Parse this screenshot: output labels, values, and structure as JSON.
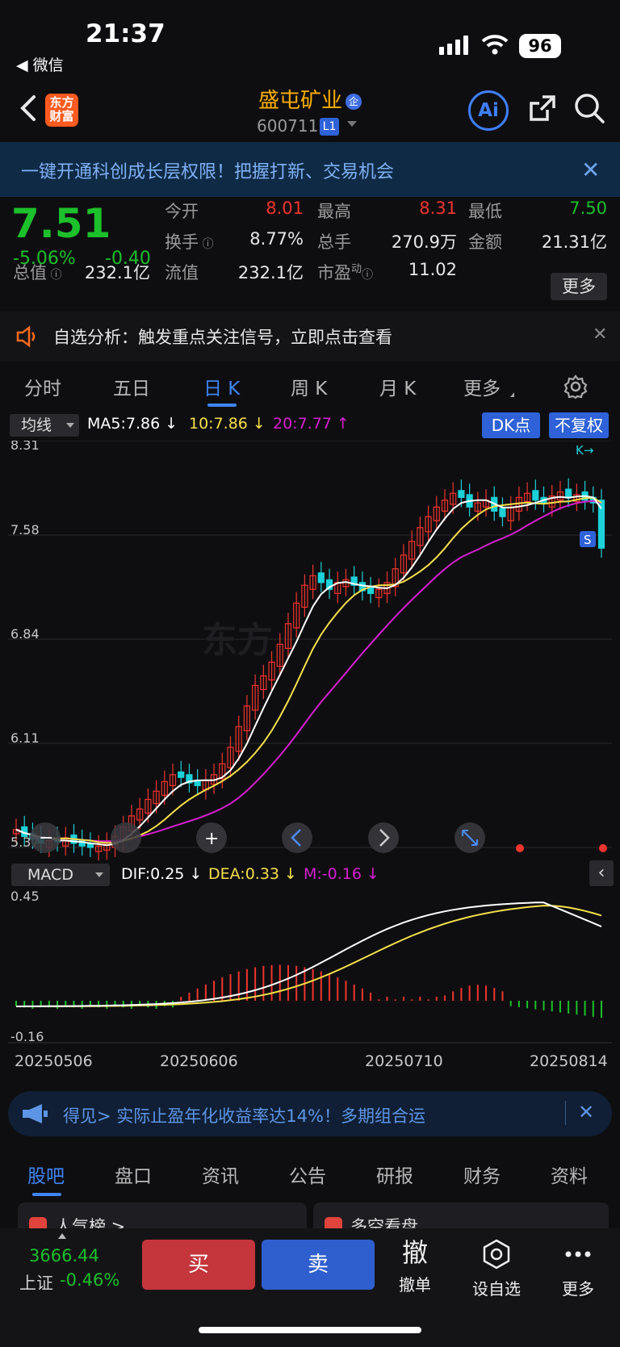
{
  "status_bar": {
    "time": "21:37",
    "back_app": "◀ 微信",
    "battery": "96"
  },
  "header": {
    "logo_line1": "东方",
    "logo_line2": "财富",
    "stock_name": "盛屯矿业",
    "enterprise_badge": "企",
    "stock_code": "600711",
    "level_badge": "L1",
    "ai_label": "Ai"
  },
  "banner": {
    "text": "一键开通科创成长层权限！把握打新、交易机会"
  },
  "quote": {
    "price": "7.51",
    "change_pct": "-5.06%",
    "change": "-0.40",
    "total_mv_label": "总值",
    "total_mv": "232.1亿",
    "open_label": "今开",
    "open": "8.01",
    "high_label": "最高",
    "high": "8.31",
    "low_label": "最低",
    "low": "7.50",
    "turnover_label": "换手",
    "turnover": "8.77%",
    "volume_label": "总手",
    "volume": "270.9万",
    "amount_label": "金额",
    "amount": "21.31亿",
    "float_mv_label": "流值",
    "float_mv": "232.1亿",
    "pe_label": "市盈",
    "pe_sup": "动",
    "pe": "11.02",
    "more_label": "更多"
  },
  "analysis": {
    "text": "自选分析：触发重点关注信号，立即点击查看"
  },
  "period_tabs": [
    "分时",
    "五日",
    "日 K",
    "周 K",
    "月 K",
    "更多"
  ],
  "ma_row": {
    "select": "均线",
    "ma5": "MA5:7.86",
    "ma10": "10:7.86",
    "ma20": "20:7.77",
    "dk_label": "DK点",
    "fq_label": "不复权"
  },
  "colors": {
    "up": "#f0342f",
    "down": "#1cd1d8",
    "ma5": "#ffffff",
    "ma10": "#f5e04a",
    "ma20": "#d61fd0",
    "accent": "#3f84f4"
  },
  "kline": {
    "axis": [
      "8.31",
      "7.58",
      "6.84",
      "6.11",
      "5.37"
    ],
    "max_marker": "K→",
    "s_marker": "S"
  },
  "macd_row": {
    "select": "MACD",
    "dif": "DIF:0.25",
    "dea": "DEA:0.33",
    "m": "M:-0.16"
  },
  "macd_axis": {
    "top": "0.45",
    "bottom": "-0.16"
  },
  "dates": [
    "20250506",
    "20250606",
    "20250710",
    "20250814"
  ],
  "promo": {
    "text": "得见>            实际止盈年化收益率达14%！多期组合运"
  },
  "bottom_tabs": [
    "股吧",
    "盘口",
    "资讯",
    "公告",
    "研报",
    "财务",
    "资料"
  ],
  "cards": {
    "hot": "人气榜 >",
    "duokong": "多空看盘"
  },
  "tradebar": {
    "index_value": "3666.44",
    "index_name": "上证",
    "index_pct": "-0.46%",
    "buy": "买",
    "sell": "卖",
    "cancel_icon": "撤",
    "cancel": "撤单",
    "watch": "设自选",
    "more": "更多"
  }
}
